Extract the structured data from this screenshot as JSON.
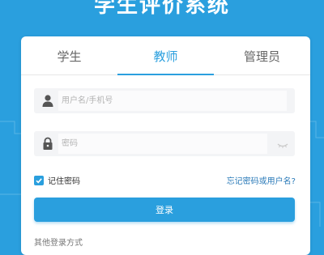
{
  "header": {
    "title": "学生评价系统"
  },
  "tabs": [
    {
      "label": "学生",
      "active": false
    },
    {
      "label": "教师",
      "active": true
    },
    {
      "label": "管理员",
      "active": false
    }
  ],
  "form": {
    "username_placeholder": "用户名/手机号",
    "password_placeholder": "密码",
    "remember_label": "记住密码",
    "remember_checked": true,
    "forgot_link": "忘记密码或用户名?",
    "login_button": "登录",
    "bottom_text": "其他登录方式"
  },
  "colors": {
    "accent": "#2a9fde",
    "link": "#2a7ab8"
  }
}
